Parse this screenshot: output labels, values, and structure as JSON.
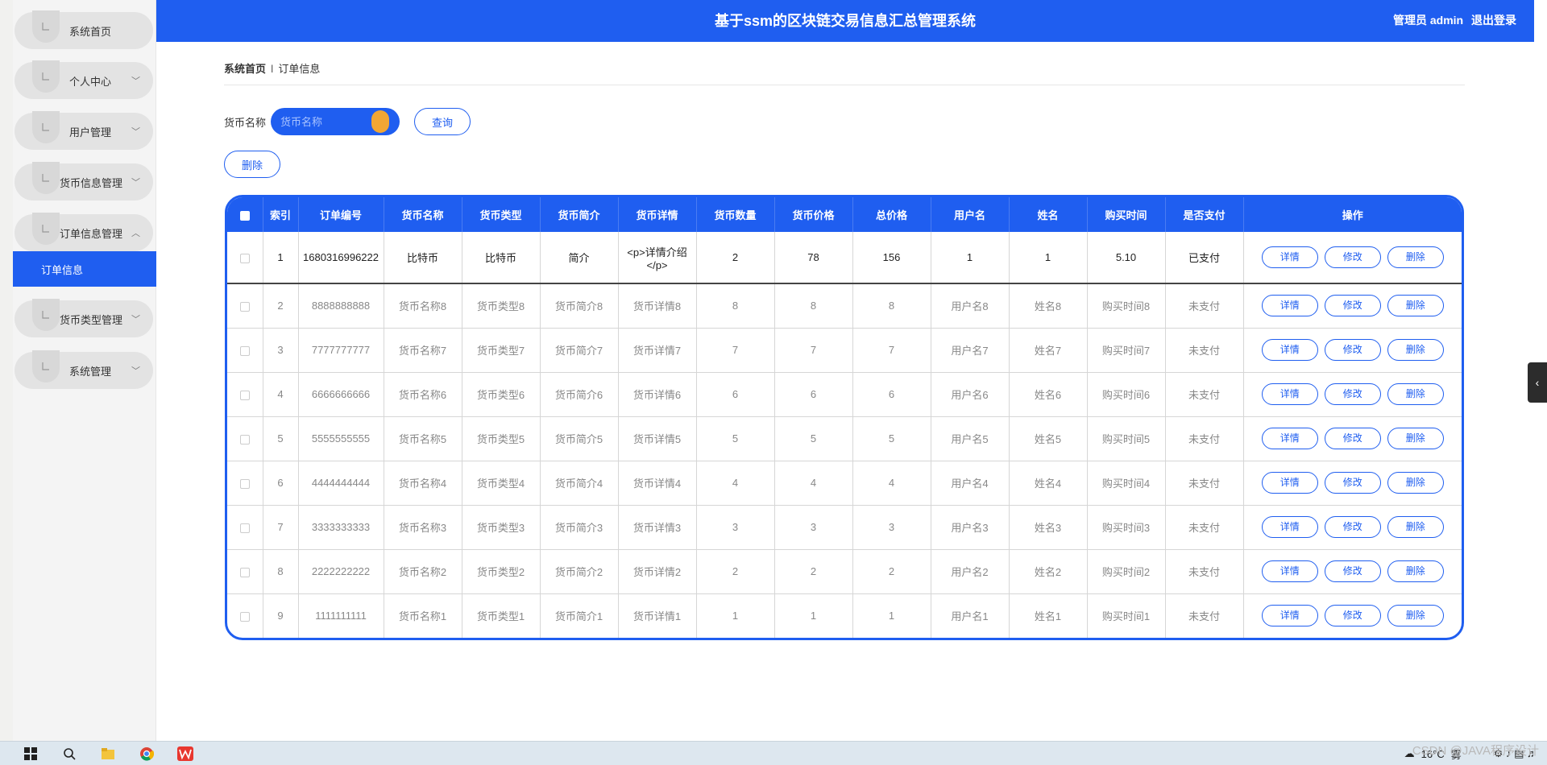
{
  "header": {
    "title": "基于ssm的区块链交易信息汇总管理系统",
    "user_label": "管理员 admin",
    "logout": "退出登录"
  },
  "sidebar": {
    "items": [
      {
        "label": "系统首页",
        "chevron": ""
      },
      {
        "label": "个人中心",
        "chevron": "﹀"
      },
      {
        "label": "用户管理",
        "chevron": "﹀"
      },
      {
        "label": "货币信息管理",
        "chevron": "﹀"
      },
      {
        "label": "订单信息管理",
        "chevron": "︿"
      },
      {
        "label": "货币类型管理",
        "chevron": "﹀"
      },
      {
        "label": "系统管理",
        "chevron": "﹀"
      }
    ],
    "active_sub": "订单信息"
  },
  "breadcrumb": {
    "home": "系统首页",
    "sep": "ǀ",
    "current": "订单信息"
  },
  "search": {
    "label": "货币名称",
    "placeholder": "货币名称",
    "query_button": "查询"
  },
  "toolbar": {
    "delete_button": "删除"
  },
  "table": {
    "headers": [
      "",
      "索引",
      "订单编号",
      "货币名称",
      "货币类型",
      "货币简介",
      "货币详情",
      "货币数量",
      "货币价格",
      "总价格",
      "用户名",
      "姓名",
      "购买时间",
      "是否支付",
      "操作"
    ],
    "actions": [
      "详情",
      "修改",
      "删除"
    ],
    "rows": [
      [
        "1",
        "1680316996222",
        "比特币",
        "比特币",
        "简介",
        "<p>详情介绍</p>",
        "2",
        "78",
        "156",
        "1",
        "1",
        "5.10",
        "已支付"
      ],
      [
        "2",
        "8888888888",
        "货币名称8",
        "货币类型8",
        "货币简介8",
        "货币详情8",
        "8",
        "8",
        "8",
        "用户名8",
        "姓名8",
        "购买时间8",
        "未支付"
      ],
      [
        "3",
        "7777777777",
        "货币名称7",
        "货币类型7",
        "货币简介7",
        "货币详情7",
        "7",
        "7",
        "7",
        "用户名7",
        "姓名7",
        "购买时间7",
        "未支付"
      ],
      [
        "4",
        "6666666666",
        "货币名称6",
        "货币类型6",
        "货币简介6",
        "货币详情6",
        "6",
        "6",
        "6",
        "用户名6",
        "姓名6",
        "购买时间6",
        "未支付"
      ],
      [
        "5",
        "5555555555",
        "货币名称5",
        "货币类型5",
        "货币简介5",
        "货币详情5",
        "5",
        "5",
        "5",
        "用户名5",
        "姓名5",
        "购买时间5",
        "未支付"
      ],
      [
        "6",
        "4444444444",
        "货币名称4",
        "货币类型4",
        "货币简介4",
        "货币详情4",
        "4",
        "4",
        "4",
        "用户名4",
        "姓名4",
        "购买时间4",
        "未支付"
      ],
      [
        "7",
        "3333333333",
        "货币名称3",
        "货币类型3",
        "货币简介3",
        "货币详情3",
        "3",
        "3",
        "3",
        "用户名3",
        "姓名3",
        "购买时间3",
        "未支付"
      ],
      [
        "8",
        "2222222222",
        "货币名称2",
        "货币类型2",
        "货币简介2",
        "货币详情2",
        "2",
        "2",
        "2",
        "用户名2",
        "姓名2",
        "购买时间2",
        "未支付"
      ],
      [
        "9",
        "1111111111",
        "货币名称1",
        "货币类型1",
        "货币简介1",
        "货币详情1",
        "1",
        "1",
        "1",
        "用户名1",
        "姓名1",
        "购买时间1",
        "未支付"
      ]
    ]
  },
  "taskbar": {
    "weather": "16°C",
    "weather_desc": "雾"
  },
  "watermark": "CSDN @JAVA程序设计",
  "colors": {
    "primary": "#1f5ef0",
    "accent": "#f2a634"
  }
}
